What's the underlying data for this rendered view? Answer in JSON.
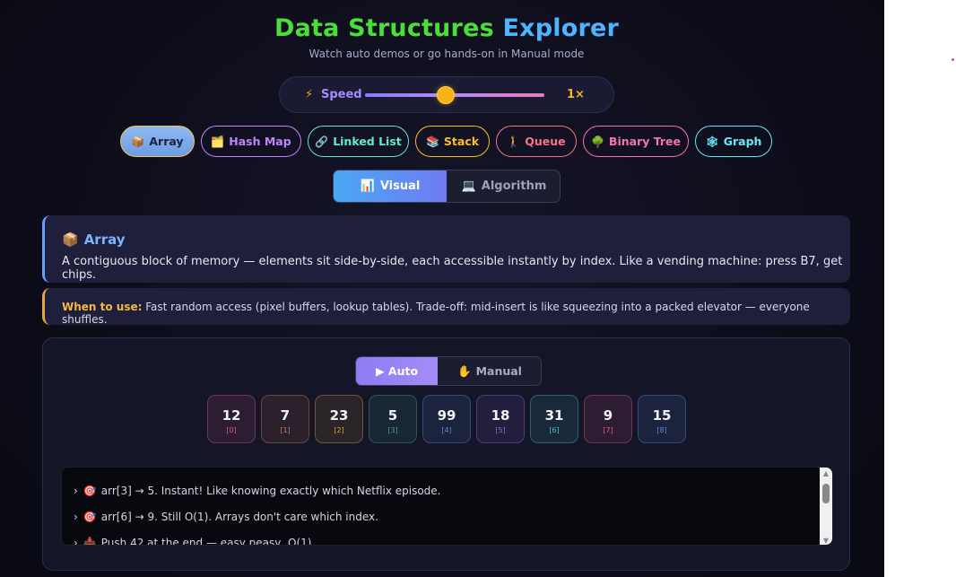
{
  "header": {
    "title_part1": "Data Structures",
    "title_part2": "Explorer",
    "subtitle": "Watch auto demos or go hands-on in Manual mode"
  },
  "speed": {
    "icon": "⚡",
    "label": "Speed",
    "value": "1×",
    "slider_fraction": 0.45
  },
  "structures": [
    {
      "icon": "📦",
      "label": "Array",
      "color": "#6e9ce0",
      "active": true
    },
    {
      "icon": "🗂️",
      "label": "Hash Map",
      "color": "#c084fc",
      "active": false
    },
    {
      "icon": "🔗",
      "label": "Linked List",
      "color": "#5eead4",
      "active": false
    },
    {
      "icon": "📚",
      "label": "Stack",
      "color": "#fbbf24",
      "active": false
    },
    {
      "icon": "🚶",
      "label": "Queue",
      "color": "#fb7185",
      "active": false
    },
    {
      "icon": "🌳",
      "label": "Binary Tree",
      "color": "#f472b6",
      "active": false
    },
    {
      "icon": "🕸",
      "label": "Graph",
      "color": "#67e8f9",
      "active": false
    }
  ],
  "view_tabs": [
    {
      "icon": "📊",
      "label": "Visual",
      "active": true
    },
    {
      "icon": "💻",
      "label": "Algorithm",
      "active": false
    }
  ],
  "info": {
    "icon": "📦",
    "title": "Array",
    "description": "A contiguous block of memory — elements sit side-by-side, each accessible instantly by index. Like a vending machine: press B7, get chips."
  },
  "when_to_use": {
    "label": "When to use:",
    "text": " Fast random access (pixel buffers, lookup tables). Trade-off: mid-insert is like squeezing into a packed elevator — everyone shuffles."
  },
  "mode": {
    "auto_label": "▶ Auto",
    "manual_icon": "✋",
    "manual_label": "Manual"
  },
  "array": [
    {
      "value": "12",
      "index": "[0]",
      "color": "#e05a8a"
    },
    {
      "value": "7",
      "index": "[1]",
      "color": "#d97a55"
    },
    {
      "value": "23",
      "index": "[2]",
      "color": "#d9a040"
    },
    {
      "value": "5",
      "index": "[3]",
      "color": "#3ea88c"
    },
    {
      "value": "99",
      "index": "[4]",
      "color": "#5c8ae0"
    },
    {
      "value": "18",
      "index": "[5]",
      "color": "#8a6ae0"
    },
    {
      "value": "31",
      "index": "[6]",
      "color": "#3fc0c8"
    },
    {
      "value": "9",
      "index": "[7]",
      "color": "#e05a8a"
    },
    {
      "value": "15",
      "index": "[8]",
      "color": "#5c8ae0"
    }
  ],
  "log": [
    {
      "icon": "🎯",
      "text": "arr[3] → 5. Instant! Like knowing exactly which Netflix episode."
    },
    {
      "icon": "🎯",
      "text": "arr[6] → 9. Still O(1). Arrays don't care which index."
    },
    {
      "icon": "📥",
      "text": "Push 42 at the end — easy peasy, O(1)"
    }
  ]
}
